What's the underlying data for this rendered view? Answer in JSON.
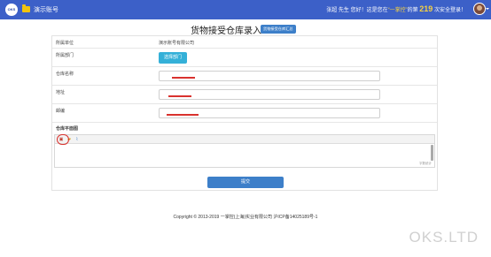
{
  "header": {
    "logo_text": "OKS",
    "account_name": "演示账号",
    "welcome_prefix": "张超 先生 您好！这是您在",
    "welcome_brand": "“一掌控”",
    "welcome_mid": "的第",
    "login_count": "219",
    "welcome_suffix": "次安全登录！"
  },
  "page": {
    "title": "货物接受仓库录入",
    "summary_badge": "货物接受仓库汇总"
  },
  "form": {
    "unit_label": "所属单位",
    "unit_value": "演示账号有限公司",
    "dept_label": "所属部门",
    "dept_button": "选择部门",
    "warehouse_name_label": "仓库名称",
    "address_label": "地址",
    "postcode_label": "邮编",
    "layout_label": "仓库平面图",
    "word_count_label": "字数统计"
  },
  "actions": {
    "submit_label": "提交"
  },
  "footer": {
    "copyright": "Copyright © 2013-2019 一掌控(上海)实业有限公司 沪ICP备14025189号-1"
  },
  "watermark": "OKS.LTD",
  "colors": {
    "topbar": "#3c60c8",
    "primary_button": "#3d7fc9",
    "choose_button": "#34b0d8",
    "highlight": "#f5d142",
    "redaction_mark": "#d9322e"
  }
}
